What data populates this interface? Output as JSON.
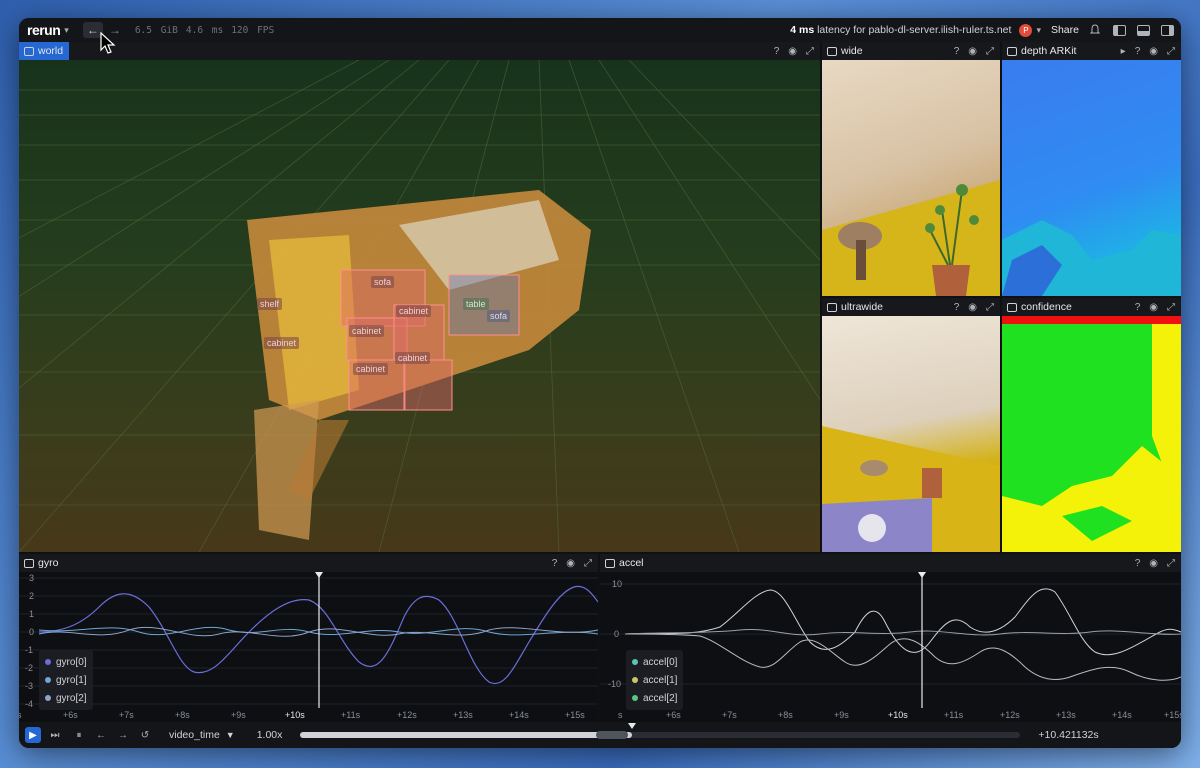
{
  "app": {
    "logo": "rerun",
    "logo_caret": "▾"
  },
  "topbar": {
    "back": "←",
    "forward": "→",
    "memory": "6.5 GiB",
    "latency_ms": "4.6 ms",
    "fps": "120 FPS",
    "latency_value": "4 ms",
    "latency_text": "latency for pablo-dl-server.ilish-ruler.ts.net",
    "avatar": "P",
    "share": "Share"
  },
  "panels": {
    "world": {
      "title": "world"
    },
    "wide": {
      "title": "wide"
    },
    "depth": {
      "title": "depth ARKit"
    },
    "ultrawide": {
      "title": "ultrawide"
    },
    "confidence": {
      "title": "confidence"
    },
    "gyro": {
      "title": "gyro"
    },
    "accel": {
      "title": "accel"
    }
  },
  "header_buttons": {
    "help": "?"
  },
  "world_labels": [
    "sofa",
    "shelf",
    "cabinet",
    "cabinet",
    "cabinet",
    "cabinet",
    "cabinet",
    "table",
    "sofa"
  ],
  "gyro": {
    "y_ticks": [
      "3",
      "2",
      "1",
      "0",
      "-1",
      "-2",
      "-3",
      "-4"
    ],
    "x_ticks": [
      "s",
      "+6s",
      "+7s",
      "+8s",
      "+9s",
      "+10s",
      "+11s",
      "+12s",
      "+13s",
      "+14s",
      "+15s"
    ],
    "legend": [
      {
        "name": "gyro[0]",
        "color": "#6b6fd8"
      },
      {
        "name": "gyro[1]",
        "color": "#6ea8d8"
      },
      {
        "name": "gyro[2]",
        "color": "#8fa5c8"
      }
    ]
  },
  "accel": {
    "y_ticks": [
      "10",
      "0",
      "-10"
    ],
    "x_ticks": [
      "s",
      "+6s",
      "+7s",
      "+8s",
      "+9s",
      "+10s",
      "+11s",
      "+12s",
      "+13s",
      "+14s",
      "+15s"
    ],
    "legend": [
      {
        "name": "accel[0]",
        "color": "#5fc4b8"
      },
      {
        "name": "accel[1]",
        "color": "#c8c86a"
      },
      {
        "name": "accel[2]",
        "color": "#5fc47f"
      }
    ]
  },
  "timeline": {
    "timeline_name": "video_time",
    "speed": "1.00x",
    "time": "+10.421132s",
    "playhead_fraction": 0.46
  }
}
